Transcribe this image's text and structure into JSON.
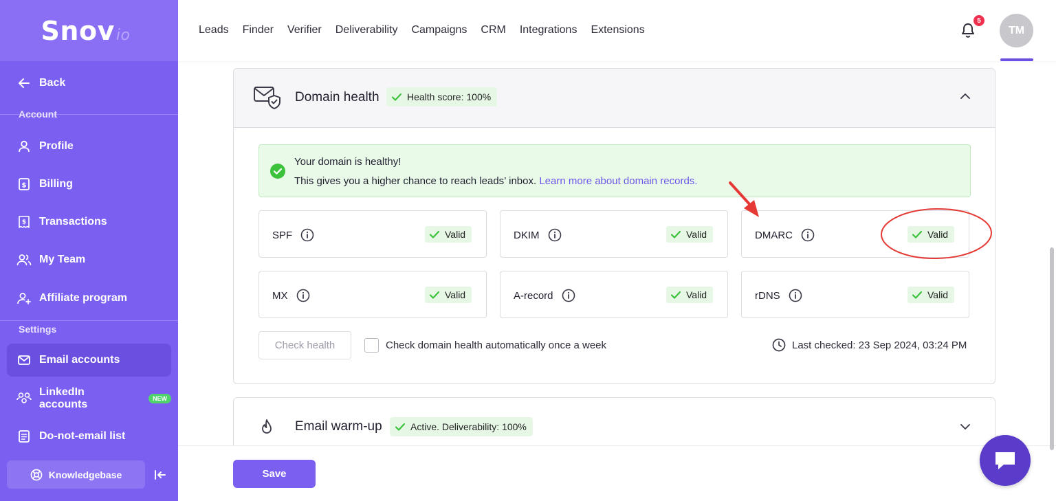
{
  "logo": {
    "main": "Snov",
    "sub": "io"
  },
  "sidebar": {
    "back": "Back",
    "account_section": "Account",
    "settings_section": "Settings",
    "items": [
      {
        "label": "Profile",
        "icon": "user-icon"
      },
      {
        "label": "Billing",
        "icon": "billing-icon"
      },
      {
        "label": "Transactions",
        "icon": "receipt-icon"
      },
      {
        "label": "My Team",
        "icon": "team-icon"
      },
      {
        "label": "Affiliate program",
        "icon": "affiliate-icon"
      },
      {
        "label": "Email accounts",
        "icon": "mail-icon",
        "active": true
      },
      {
        "label": "LinkedIn accounts",
        "icon": "linkedin-people-icon",
        "badge": "NEW"
      },
      {
        "label": "Do-not-email list",
        "icon": "list-icon"
      }
    ],
    "knowledgebase": "Knowledgebase"
  },
  "topnav": {
    "links": [
      "Leads",
      "Finder",
      "Verifier",
      "Deliverability",
      "Campaigns",
      "CRM",
      "Integrations",
      "Extensions"
    ],
    "notification_count": "5",
    "avatar_initials": "TM"
  },
  "domain_health": {
    "title": "Domain health",
    "score": "Health score: 100%",
    "alert_title": "Your domain is healthy!",
    "alert_text": "This gives you a higher chance to reach leads’ inbox. ",
    "alert_link": "Learn more about domain records.",
    "records": [
      {
        "name": "SPF",
        "status": "Valid"
      },
      {
        "name": "DKIM",
        "status": "Valid"
      },
      {
        "name": "DMARC",
        "status": "Valid"
      },
      {
        "name": "MX",
        "status": "Valid"
      },
      {
        "name": "A-record",
        "status": "Valid"
      },
      {
        "name": "rDNS",
        "status": "Valid"
      }
    ],
    "check_button": "Check health",
    "auto_check_label": "Check domain health automatically once a week",
    "last_checked": "Last checked: 23 Sep 2024, 03:24 PM"
  },
  "warmup": {
    "title": "Email warm-up",
    "status": "Active. Deliverability: 100%"
  },
  "save_label": "Save",
  "colors": {
    "brand": "#7b5ff0",
    "success": "#3cc13b",
    "link": "#6b57e8",
    "annotation": "#e53935"
  }
}
